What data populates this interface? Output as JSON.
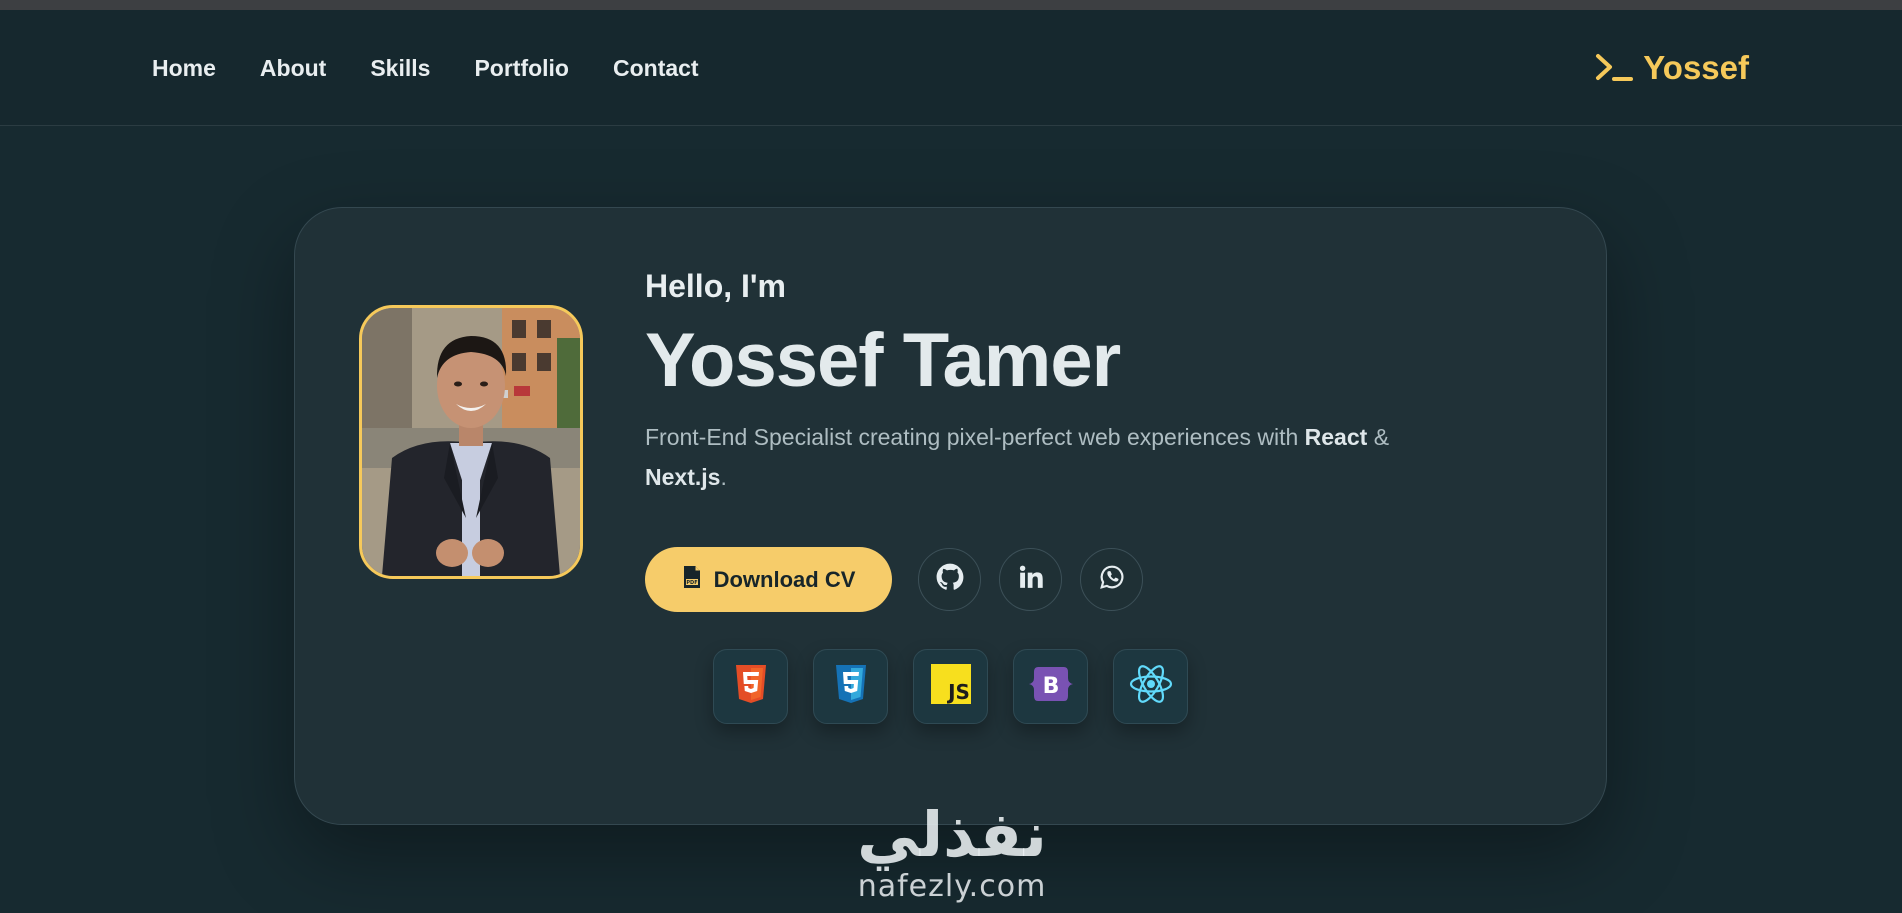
{
  "nav": {
    "links": [
      "Home",
      "About",
      "Skills",
      "Portfolio",
      "Contact"
    ],
    "brand_prompt_icon": "terminal-prompt-icon",
    "brand_name": "Yossef"
  },
  "hero": {
    "greeting": "Hello, I'm",
    "name": "Yossef Tamer",
    "tagline_part1": "Front-End Specialist creating pixel-perfect web experiences with ",
    "tagline_react": "React",
    "tagline_part2": " & ",
    "tagline_next": "Next.js",
    "tagline_end": ".",
    "cv_button": "Download CV",
    "cv_icon": "pdf-file-icon",
    "socials": [
      "github-icon",
      "linkedin-icon",
      "whatsapp-icon"
    ],
    "tech_icons": [
      "html5-icon",
      "css3-icon",
      "javascript-icon",
      "bootstrap-icon",
      "react-icon"
    ]
  },
  "watermark": {
    "arabic": "نفذلي",
    "latin": "nafezly.com"
  },
  "colors": {
    "background": "#172a30",
    "accent": "#f6c95a",
    "card": "#203137"
  }
}
